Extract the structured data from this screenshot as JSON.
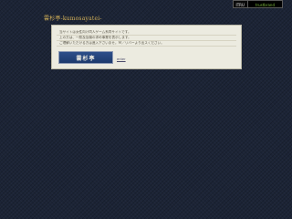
{
  "badge": {
    "left_label": "ITRU",
    "right_label": "trustbrand"
  },
  "site": {
    "title": "雲杉亭-kumosayatei-"
  },
  "notice": {
    "lines": [
      "当サイトは女性向け同人ゲーム系同サイトです。",
      "上の方は、一般及及機の求め事業を表示します。",
      "ご理解いただける方は進入下さいませ。Ｍ／リバーより出スください。"
    ],
    "enter_banner_label": "雲杉亭",
    "enter_link_label": "enter"
  },
  "colors": {
    "background": "#1c2436",
    "title": "#d9b55a",
    "panel": "#ecebe0",
    "banner": "#1d3a6c"
  }
}
